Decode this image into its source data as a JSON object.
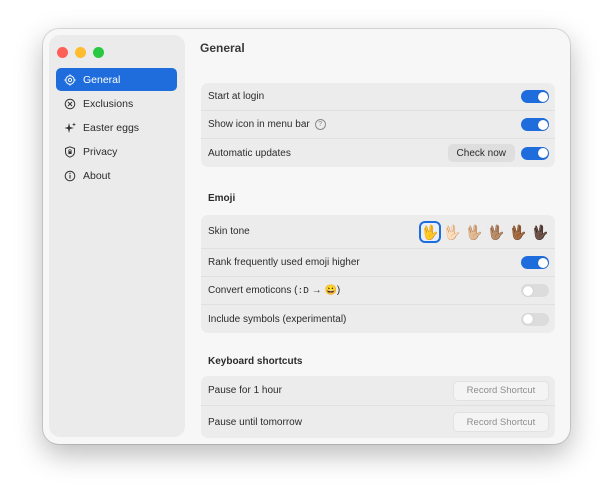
{
  "sidebar": {
    "items": [
      {
        "label": "General",
        "icon": "gear-icon"
      },
      {
        "label": "Exclusions",
        "icon": "x-circle-icon"
      },
      {
        "label": "Easter eggs",
        "icon": "sparkle-icon"
      },
      {
        "label": "Privacy",
        "icon": "shield-icon"
      },
      {
        "label": "About",
        "icon": "info-icon"
      }
    ]
  },
  "page": {
    "title": "General"
  },
  "general": {
    "start_at_login": "Start at login",
    "show_icon": "Show icon in menu bar",
    "auto_updates": "Automatic updates",
    "check_now": "Check now"
  },
  "emoji": {
    "title": "Emoji",
    "skin_tone": "Skin tone",
    "rank_frequent": "Rank frequently used emoji higher",
    "convert_prefix": "Convert emoticons (",
    "convert_code": ":D",
    "convert_arrow": "→",
    "convert_suffix": ")",
    "convert_emoji": "😀",
    "include_symbols": "Include symbols (experimental)",
    "tones": [
      "🖖",
      "🖖🏻",
      "🖖🏼",
      "🖖🏽",
      "🖖🏾",
      "🖖🏿"
    ]
  },
  "shortcuts": {
    "title": "Keyboard shortcuts",
    "pause_hour": "Pause for 1 hour",
    "pause_tomorrow": "Pause until tomorrow",
    "record_label": "Record Shortcut"
  },
  "colors": {
    "accent": "#1f6ddc"
  }
}
